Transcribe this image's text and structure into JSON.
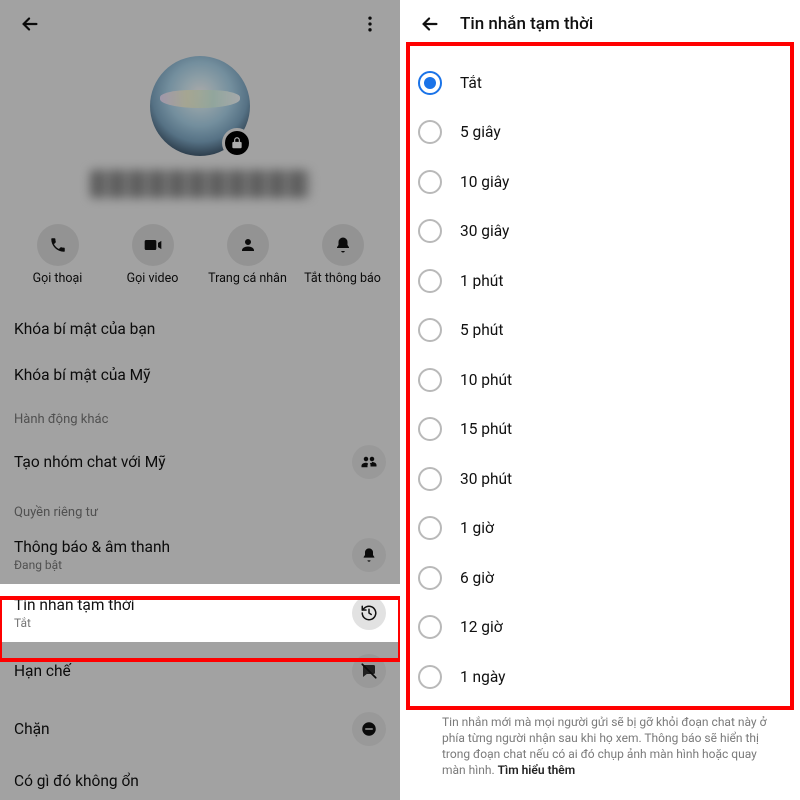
{
  "left": {
    "quick_actions": {
      "call": {
        "label": "Gọi thoại",
        "icon": "phone-icon"
      },
      "video": {
        "label": "Gọi video",
        "icon": "video-icon"
      },
      "profile": {
        "label": "Trang cá nhân",
        "icon": "person-icon"
      },
      "mute": {
        "label": "Tắt thông báo",
        "icon": "bell-icon"
      }
    },
    "rows": {
      "your_key": {
        "label": "Khóa bí mật của bạn"
      },
      "their_key": {
        "label": "Khóa bí mật của Mỹ"
      }
    },
    "section_other": "Hành động khác",
    "rows2": {
      "create_group": {
        "label": "Tạo nhóm chat với Mỹ",
        "icon": "group-icon"
      }
    },
    "section_privacy": "Quyền riêng tư",
    "rows3": {
      "notif": {
        "label": "Thông báo & âm thanh",
        "sub": "Đang bật",
        "icon": "bell-icon"
      },
      "ephemeral": {
        "label": "Tin nhắn tạm thời",
        "sub": "Tắt",
        "icon": "history-icon"
      },
      "restrict": {
        "label": "Hạn chế",
        "icon": "slash-icon"
      },
      "block": {
        "label": "Chặn",
        "icon": "minus-circle-icon"
      },
      "something": {
        "label": "Có gì đó không ổn"
      }
    }
  },
  "right": {
    "title": "Tin nhắn tạm thời",
    "options": [
      {
        "label": "Tắt",
        "selected": true
      },
      {
        "label": "5 giây",
        "selected": false
      },
      {
        "label": "10 giây",
        "selected": false
      },
      {
        "label": "30 giây",
        "selected": false
      },
      {
        "label": "1 phút",
        "selected": false
      },
      {
        "label": "5 phút",
        "selected": false
      },
      {
        "label": "10 phút",
        "selected": false
      },
      {
        "label": "15 phút",
        "selected": false
      },
      {
        "label": "30 phút",
        "selected": false
      },
      {
        "label": "1 giờ",
        "selected": false
      },
      {
        "label": "6 giờ",
        "selected": false
      },
      {
        "label": "12 giờ",
        "selected": false
      },
      {
        "label": "1 ngày",
        "selected": false
      }
    ],
    "footer": "Tin nhắn mới mà mọi người gửi sẽ bị gỡ khỏi đoạn chat này ở phía từng người nhận sau khi họ xem. Thông báo sẽ hiển thị trong đoạn chat nếu có ai đó chụp ảnh màn hình hoặc quay màn hình. ",
    "footer_more": "Tìm hiểu thêm"
  }
}
